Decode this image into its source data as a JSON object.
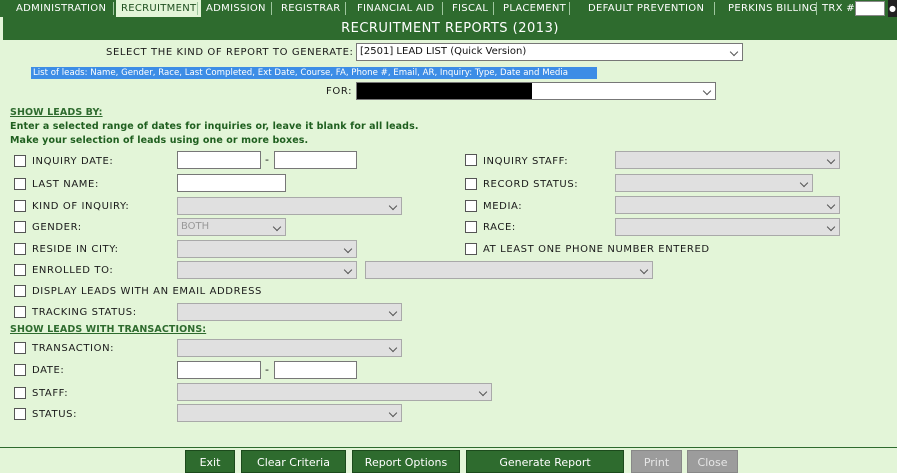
{
  "nav": {
    "tabs": [
      "ADMINISTRATION",
      "RECRUITMENT",
      "ADMISSION",
      "REGISTRAR",
      "FINANCIAL AID",
      "FISCAL",
      "PLACEMENT",
      "DEFAULT PREVENTION",
      "PERKINS BILLING"
    ],
    "active_tab": "RECRUITMENT",
    "trx_label": "TRX #:",
    "trx_value": ""
  },
  "title": "RECRUITMENT REPORTS (2013)",
  "report": {
    "select_label": "SELECT THE KIND OF REPORT TO GENERATE:",
    "selected": "[2501] LEAD LIST (Quick Version)",
    "description": "List of leads: Name, Gender, Race, Last Completed, Ext Date, Course, FA, Phone #, Email, AR, Inquiry: Type, Date and Media",
    "for_label": "FOR:"
  },
  "show_leads": {
    "header": "SHOW LEADS BY:",
    "instr1": "Enter a selected range of dates for inquiries or, leave it blank for all leads.",
    "instr2": "Make your selection of leads using one or more boxes.",
    "inquiry_date": "INQUIRY DATE:",
    "last_name": "LAST NAME:",
    "kind_of_inquiry": "KIND OF INQUIRY:",
    "gender": "GENDER:",
    "gender_value": "BOTH",
    "reside_in_city": "RESIDE IN CITY:",
    "enrolled_to": "ENROLLED TO:",
    "display_email": "DISPLAY LEADS WITH AN EMAIL ADDRESS",
    "tracking_status": "TRACKING STATUS:",
    "inquiry_staff": "INQUIRY STAFF:",
    "record_status": "RECORD STATUS:",
    "media": "MEDIA:",
    "race": "RACE:",
    "phone_entered": "AT LEAST ONE PHONE NUMBER ENTERED",
    "date_separator": "-"
  },
  "transactions": {
    "header": "SHOW LEADS WITH TRANSACTIONS:",
    "transaction": "TRANSACTION:",
    "date": "DATE:",
    "staff": "STAFF:",
    "status": "STATUS:"
  },
  "buttons": {
    "exit": "Exit",
    "clear": "Clear Criteria",
    "options": "Report Options",
    "generate": "Generate Report",
    "print": "Print",
    "close": "Close"
  },
  "colors": {
    "primary_green": "#2e6b2e",
    "background": "#e3f5d8",
    "highlight_blue": "#3d8de6",
    "disabled_gray": "#9c9c9c"
  }
}
